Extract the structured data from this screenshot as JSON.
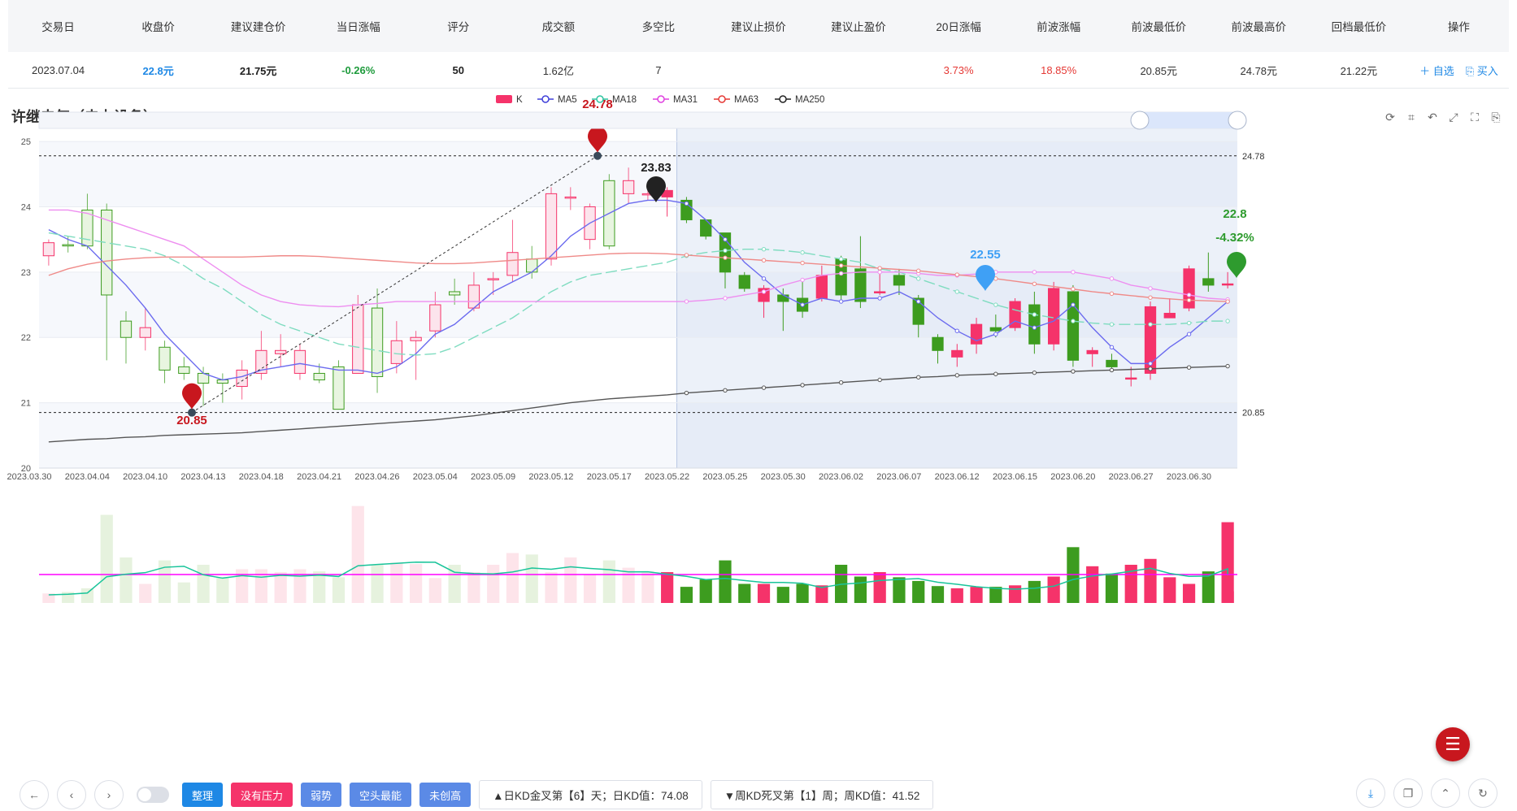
{
  "summary": {
    "headers": [
      "交易日",
      "收盘价",
      "建议建仓价",
      "当日涨幅",
      "评分",
      "成交额",
      "多空比",
      "建议止损价",
      "建议止盈价",
      "20日涨幅",
      "前波涨幅",
      "前波最低价",
      "前波最高价",
      "回档最低价",
      "操作"
    ],
    "values": [
      "2023.07.04",
      "22.8元",
      "21.75元",
      "-0.26%",
      "50",
      "1.62亿",
      "7",
      "",
      "",
      "3.73%",
      "18.85%",
      "20.85元",
      "24.78元",
      "21.22元"
    ],
    "actions": {
      "watch": "＋ 自选",
      "buy": "买入"
    }
  },
  "chart_title": "许继电气（电力设备）",
  "legend": [
    {
      "name": "K",
      "color": "#f5336a"
    },
    {
      "name": "MA5",
      "color": "#3f3fd9"
    },
    {
      "name": "MA18",
      "color": "#2ec4a0"
    },
    {
      "name": "MA31",
      "color": "#e040e0"
    },
    {
      "name": "MA63",
      "color": "#e53935"
    },
    {
      "name": "MA250",
      "color": "#222222"
    }
  ],
  "chart_data": {
    "type": "candlestick",
    "y_ticks": [
      20,
      21,
      22,
      23,
      24,
      25
    ],
    "ylim": [
      20,
      25.2
    ],
    "x_tick_labels": [
      "2023.03.30",
      "2023.04.04",
      "2023.04.10",
      "2023.04.13",
      "2023.04.18",
      "2023.04.21",
      "2023.04.26",
      "2023.05.04",
      "2023.05.09",
      "2023.05.12",
      "2023.05.17",
      "2023.05.22",
      "2023.05.25",
      "2023.05.30",
      "2023.06.02",
      "2023.06.07",
      "2023.06.12",
      "2023.06.15",
      "2023.06.20",
      "2023.06.27",
      "2023.06.30"
    ],
    "candles": [
      [
        23.25,
        23.45,
        23.1,
        23.5
      ],
      [
        23.42,
        23.4,
        23.3,
        23.55
      ],
      [
        23.95,
        23.4,
        23.35,
        24.2
      ],
      [
        23.95,
        22.65,
        21.65,
        24.05
      ],
      [
        22.25,
        22.0,
        21.6,
        22.4
      ],
      [
        22.0,
        22.15,
        21.8,
        22.45
      ],
      [
        21.85,
        21.5,
        21.3,
        21.95
      ],
      [
        21.55,
        21.45,
        21.35,
        21.7
      ],
      [
        21.45,
        21.3,
        20.95,
        21.55
      ],
      [
        21.35,
        21.3,
        21.0,
        21.45
      ],
      [
        21.25,
        21.5,
        21.05,
        21.65
      ],
      [
        21.45,
        21.8,
        21.35,
        22.1
      ],
      [
        21.75,
        21.8,
        21.55,
        22.05
      ],
      [
        21.45,
        21.8,
        21.35,
        21.9
      ],
      [
        21.45,
        21.35,
        21.3,
        21.6
      ],
      [
        21.55,
        20.9,
        20.9,
        21.65
      ],
      [
        21.45,
        22.5,
        21.45,
        22.65
      ],
      [
        22.45,
        21.4,
        21.15,
        22.75
      ],
      [
        21.6,
        21.95,
        21.45,
        22.25
      ],
      [
        21.95,
        22.0,
        21.35,
        22.1
      ],
      [
        22.1,
        22.5,
        22.0,
        22.7
      ],
      [
        22.7,
        22.65,
        22.5,
        22.9
      ],
      [
        22.45,
        22.8,
        22.4,
        23.0
      ],
      [
        22.9,
        22.9,
        22.65,
        23.0
      ],
      [
        22.95,
        23.3,
        22.85,
        23.8
      ],
      [
        23.2,
        23.0,
        22.9,
        23.4
      ],
      [
        23.2,
        24.2,
        23.1,
        24.3
      ],
      [
        24.15,
        24.15,
        23.95,
        24.3
      ],
      [
        23.5,
        24.0,
        23.35,
        24.05
      ],
      [
        24.4,
        23.4,
        23.35,
        24.5
      ],
      [
        24.2,
        24.4,
        24.05,
        24.6
      ],
      [
        24.2,
        24.2,
        24.1,
        24.3
      ],
      [
        24.15,
        24.25,
        23.85,
        24.3
      ],
      [
        24.1,
        23.8,
        23.75,
        24.15
      ],
      [
        23.8,
        23.55,
        23.5,
        23.8
      ],
      [
        23.6,
        23.0,
        22.75,
        23.6
      ],
      [
        22.95,
        22.75,
        22.7,
        23.0
      ],
      [
        22.55,
        22.75,
        22.3,
        22.8
      ],
      [
        22.65,
        22.55,
        22.1,
        22.75
      ],
      [
        22.6,
        22.4,
        22.3,
        22.85
      ],
      [
        22.6,
        22.95,
        22.55,
        23.1
      ],
      [
        23.2,
        22.65,
        22.55,
        23.25
      ],
      [
        23.05,
        22.55,
        22.45,
        23.55
      ],
      [
        22.7,
        22.7,
        22.65,
        23.0
      ],
      [
        22.95,
        22.8,
        22.65,
        23.05
      ],
      [
        22.6,
        22.2,
        22.0,
        22.65
      ],
      [
        22.0,
        21.8,
        21.6,
        22.05
      ],
      [
        21.7,
        21.8,
        21.55,
        21.9
      ],
      [
        21.9,
        22.2,
        21.75,
        22.3
      ],
      [
        22.15,
        22.1,
        22.0,
        22.35
      ],
      [
        22.15,
        22.55,
        22.1,
        22.6
      ],
      [
        22.5,
        21.9,
        21.75,
        22.7
      ],
      [
        21.9,
        22.75,
        21.8,
        22.85
      ],
      [
        22.7,
        21.65,
        21.55,
        22.8
      ],
      [
        21.75,
        21.8,
        21.55,
        21.85
      ],
      [
        21.65,
        21.55,
        21.5,
        21.75
      ],
      [
        21.38,
        21.38,
        21.25,
        21.55
      ],
      [
        21.45,
        22.47,
        21.35,
        22.55
      ],
      [
        22.3,
        22.37,
        22.3,
        22.6
      ],
      [
        22.45,
        23.05,
        22.4,
        23.1
      ],
      [
        22.9,
        22.8,
        22.7,
        23.3
      ],
      [
        22.82,
        22.82,
        22.75,
        23.0
      ]
    ],
    "ma": {
      "MA5": [
        23.65,
        23.5,
        23.4,
        23.1,
        22.8,
        22.45,
        22.05,
        21.75,
        21.45,
        21.35,
        21.4,
        21.5,
        21.55,
        21.6,
        21.55,
        21.5,
        21.5,
        21.45,
        21.55,
        21.75,
        22.05,
        22.2,
        22.45,
        22.7,
        22.85,
        23.0,
        23.25,
        23.55,
        23.75,
        23.9,
        24.05,
        24.1,
        24.1,
        24.05,
        23.8,
        23.5,
        23.15,
        22.9,
        22.65,
        22.5,
        22.6,
        22.55,
        22.6,
        22.6,
        22.7,
        22.55,
        22.3,
        22.1,
        21.95,
        22.05,
        22.25,
        22.15,
        22.25,
        22.5,
        22.15,
        21.85,
        21.6,
        21.6,
        21.85,
        22.05,
        22.3,
        22.55,
        22.6
      ],
      "MA18": [
        23.6,
        23.55,
        23.5,
        23.45,
        23.4,
        23.35,
        23.25,
        23.1,
        22.9,
        22.75,
        22.55,
        22.35,
        22.2,
        22.1,
        22.0,
        21.9,
        21.85,
        21.8,
        21.75,
        21.73,
        21.75,
        21.85,
        22.0,
        22.15,
        22.3,
        22.5,
        22.7,
        22.85,
        22.95,
        23.0,
        23.05,
        23.1,
        23.15,
        23.25,
        23.3,
        23.33,
        23.35,
        23.35,
        23.33,
        23.3,
        23.25,
        23.2,
        23.15,
        23.05,
        23.0,
        22.9,
        22.8,
        22.7,
        22.6,
        22.5,
        22.42,
        22.35,
        22.3,
        22.25,
        22.22,
        22.2,
        22.2,
        22.2,
        22.2,
        22.22,
        22.25,
        22.25,
        22.25
      ],
      "MA31": [
        23.95,
        23.95,
        23.9,
        23.8,
        23.7,
        23.6,
        23.5,
        23.4,
        23.2,
        23.0,
        22.8,
        22.65,
        22.55,
        22.5,
        22.48,
        22.47,
        22.5,
        22.52,
        22.55,
        22.55,
        22.55,
        22.55,
        22.55,
        22.55,
        22.55,
        22.55,
        22.55,
        22.55,
        22.55,
        22.55,
        22.55,
        22.55,
        22.55,
        22.55,
        22.57,
        22.6,
        22.65,
        22.7,
        22.8,
        22.88,
        22.95,
        22.98,
        23.0,
        23.0,
        23.0,
        22.98,
        22.95,
        22.95,
        22.97,
        23.0,
        23.0,
        23.0,
        23.0,
        23.0,
        22.95,
        22.9,
        22.8,
        22.75,
        22.7,
        22.65,
        22.6,
        22.58,
        22.57
      ],
      "MA63": [
        22.95,
        23.05,
        23.12,
        23.17,
        23.2,
        23.22,
        23.23,
        23.23,
        23.23,
        23.23,
        23.23,
        23.24,
        23.25,
        23.25,
        23.24,
        23.22,
        23.2,
        23.18,
        23.16,
        23.14,
        23.13,
        23.13,
        23.14,
        23.16,
        23.18,
        23.2,
        23.22,
        23.24,
        23.26,
        23.28,
        23.29,
        23.29,
        23.28,
        23.26,
        23.24,
        23.22,
        23.2,
        23.18,
        23.16,
        23.14,
        23.12,
        23.1,
        23.08,
        23.06,
        23.04,
        23.02,
        22.99,
        22.96,
        22.93,
        22.9,
        22.86,
        22.82,
        22.78,
        22.74,
        22.7,
        22.67,
        22.64,
        22.61,
        22.59,
        22.57,
        22.56,
        22.55,
        22.55
      ],
      "MA250": [
        20.4,
        20.42,
        20.44,
        20.45,
        20.47,
        20.48,
        20.5,
        20.51,
        20.52,
        20.53,
        20.54,
        20.56,
        20.58,
        20.6,
        20.62,
        20.64,
        20.66,
        20.68,
        20.7,
        20.72,
        20.74,
        20.77,
        20.8,
        20.84,
        20.88,
        20.92,
        20.96,
        21.0,
        21.03,
        21.06,
        21.08,
        21.1,
        21.12,
        21.15,
        21.17,
        21.19,
        21.21,
        21.23,
        21.25,
        21.27,
        21.29,
        21.31,
        21.33,
        21.35,
        21.37,
        21.39,
        21.4,
        21.42,
        21.43,
        21.44,
        21.45,
        21.46,
        21.47,
        21.48,
        21.49,
        21.5,
        21.51,
        21.52,
        21.53,
        21.54,
        21.55,
        21.56,
        21.57
      ]
    },
    "volume": [
      1.3,
      1.5,
      2.0,
      12.0,
      6.2,
      2.6,
      5.8,
      2.8,
      5.2,
      3.5,
      4.6,
      4.6,
      4.2,
      4.6,
      4.3,
      3.5,
      13.2,
      5.2,
      5.5,
      5.3,
      3.4,
      5.2,
      4.2,
      5.2,
      6.8,
      6.6,
      4.2,
      6.2,
      3.9,
      5.8,
      4.8,
      4.3,
      4.2,
      2.2,
      3.2,
      5.8,
      2.6,
      2.6,
      2.2,
      2.6,
      2.4,
      5.2,
      3.6,
      4.2,
      3.5,
      3.0,
      2.3,
      2.0,
      2.2,
      2.2,
      2.4,
      3.0,
      3.6,
      7.6,
      5.0,
      4.0,
      5.2,
      6.0,
      3.5,
      2.6,
      4.3,
      11.0,
      1.6
    ],
    "markers": [
      {
        "label": "24.78",
        "color": "#c8171e"
      },
      {
        "label": "20.85",
        "color": "#c8171e"
      },
      {
        "label": "23.83",
        "color": "#222222"
      },
      {
        "label": "22.55",
        "color": "#3fa0f5"
      },
      {
        "label": "22.8",
        "color": "#2e9b2e"
      },
      {
        "label": "-4.32%",
        "color": "#2e9b2e"
      }
    ],
    "price_lines": [
      "24.78",
      "20.85"
    ]
  },
  "bottom": {
    "tags": [
      "整理",
      "没有压力",
      "弱势",
      "空头最能",
      "未创高"
    ],
    "info1": "▲日KD金叉第【6】天；日KD值：74.08",
    "info2": "▼周KD死叉第【1】周；周KD值：41.52"
  }
}
